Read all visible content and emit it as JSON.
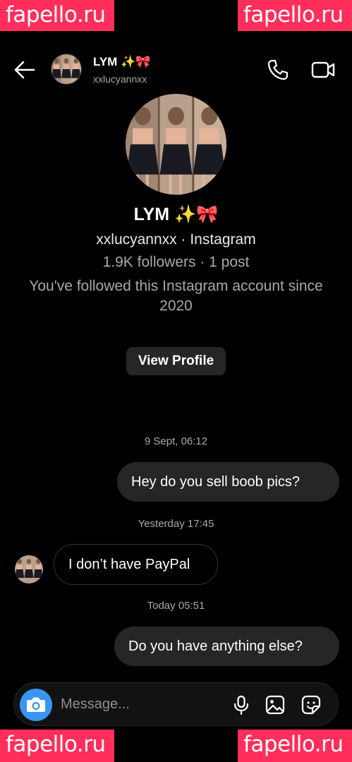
{
  "watermarks": {
    "text": "fapello.ru"
  },
  "header": {
    "name": "LYM ✨🎀",
    "username": "xxlucyannxx"
  },
  "profile": {
    "name": "LYM ✨🎀",
    "subtitle": "xxlucyannxx · Instagram",
    "stats": "1.9K followers · 1 post",
    "note": "You've followed this Instagram account since 2020",
    "view_profile_label": "View Profile"
  },
  "thread": {
    "timestamp_1": "9 Sept, 06:12",
    "msg_1": "Hey do you sell boob pics?",
    "timestamp_2": "Yesterday 17:45",
    "msg_2": "I don’t have PayPal",
    "timestamp_3": "Today 05:51",
    "msg_3": "Do you have anything else?"
  },
  "composer": {
    "placeholder": "Message..."
  },
  "colors": {
    "background": "#000000",
    "bubble_outgoing": "#262626",
    "camera_button": "#3797f0",
    "watermark": "#ff2e5b"
  },
  "icons": [
    "back-arrow-icon",
    "phone-icon",
    "video-camera-icon",
    "camera-icon",
    "microphone-icon",
    "gallery-icon",
    "sticker-icon"
  ]
}
